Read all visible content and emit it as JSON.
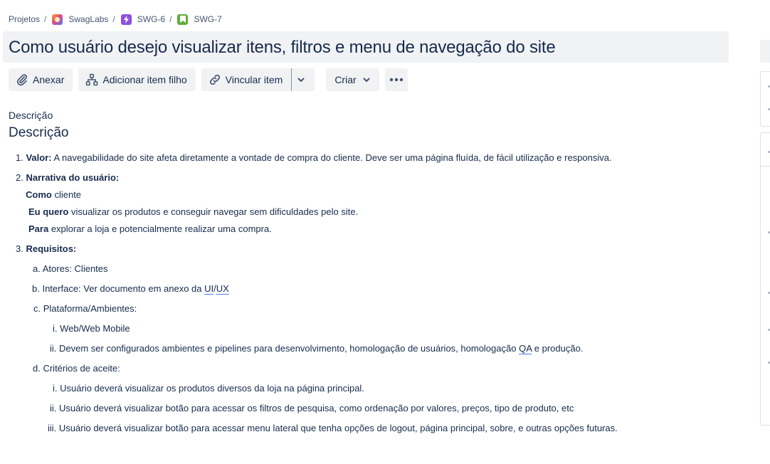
{
  "breadcrumb": {
    "projects": "Projetos",
    "project": "SwagLabs",
    "epic": "SWG-6",
    "story": "SWG-7",
    "separator": "/"
  },
  "issue": {
    "title": "Como usuário desejo visualizar itens, filtros e menu de navegação do site"
  },
  "toolbar": {
    "attach": "Anexar",
    "add_child": "Adicionar item filho",
    "link": "Vincular item",
    "create": "Criar"
  },
  "description": {
    "label": "Descrição",
    "heading": "Descrição",
    "item1_num": "1.",
    "item1_bold": "Valor:",
    "item1_text": " A navegabilidade do site afeta diretamente a vontade de compra do cliente. Deve ser uma página fluída, de fácil utilização e responsiva.",
    "item2_num": "2.",
    "item2_bold": "Narrativa do usuário:",
    "as_bold": "Como",
    "as_text": " cliente",
    "want_bold": "Eu quero",
    "want_text": " visualizar os produtos e conseguir navegar sem dificuldades pelo site.",
    "so_bold": "Para",
    "so_text": " explorar a loja e potencialmente realizar uma compra.",
    "item3_num": "3.",
    "item3_bold": "Requisitos:",
    "a_num": "a.",
    "a_text": "Atores: Clientes",
    "b_num": "b.",
    "b_text": "Interface: Ver documento em anexo da ",
    "b_ui": "UI",
    "b_slash": "/",
    "b_ux": "UX",
    "c_num": "c.",
    "c_text": "Plataforma/Ambientes:",
    "c_i_num": "i.",
    "c_i_text": "Web/Web Mobile",
    "c_ii_num": "ii.",
    "c_ii_text": "Devem ser configurados ambientes e pipelines para desenvolvimento, homologação de usuários, homologação ",
    "c_ii_qa": "QA",
    "c_ii_end": " e produção.",
    "d_num": "d.",
    "d_text": "Critérios de aceite:",
    "d_i_num": "i.",
    "d_i_text": "Usuário deverá visualizar os produtos diversos da loja na página principal.",
    "d_ii_num": "ii.",
    "d_ii_text": "Usuário deverá visualizar botão para acessar os filtros de pesquisa, como ordenação por valores, preços, tipo de produto, etc",
    "d_iii_num": "iii.",
    "d_iii_text": "Usuário deverá visualizar botão para acessar menu lateral que tenha opções de logout, página principal, sobre, e outras opções futuras."
  },
  "colors": {
    "text": "#172b4d",
    "button_bg": "#f1f2f4",
    "epic_icon": "#8f4fe0",
    "story_icon": "#5ead3c",
    "link_underline": "#4a7cf0"
  }
}
